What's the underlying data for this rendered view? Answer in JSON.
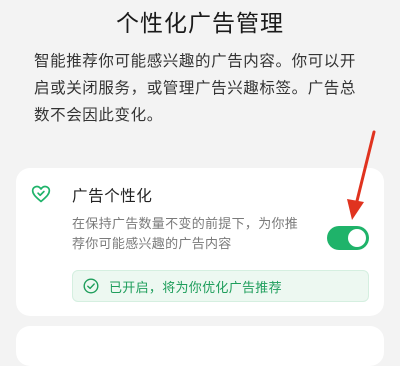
{
  "header": {
    "title": "个性化广告管理",
    "description": "智能推荐你可能感兴趣的广告内容。你可以开启或关闭服务，或管理广告兴趣标签。广告总数不会因此变化。"
  },
  "setting": {
    "icon": "heart-icon",
    "title": "广告个性化",
    "description": "在保持广告数量不变的前提下，为你推荐你可能感兴趣的广告内容",
    "toggle_on": true,
    "status_icon": "check-circle-icon",
    "status_text": "已开启，将为你优化广告推荐"
  },
  "annotation": {
    "type": "red-arrow-icon",
    "color": "#e0331f"
  },
  "colors": {
    "accent": "#1fb36a",
    "background": "#f3f3f3",
    "card": "#ffffff",
    "status_bg": "#edf8f1",
    "status_text": "#1f9e5c"
  }
}
